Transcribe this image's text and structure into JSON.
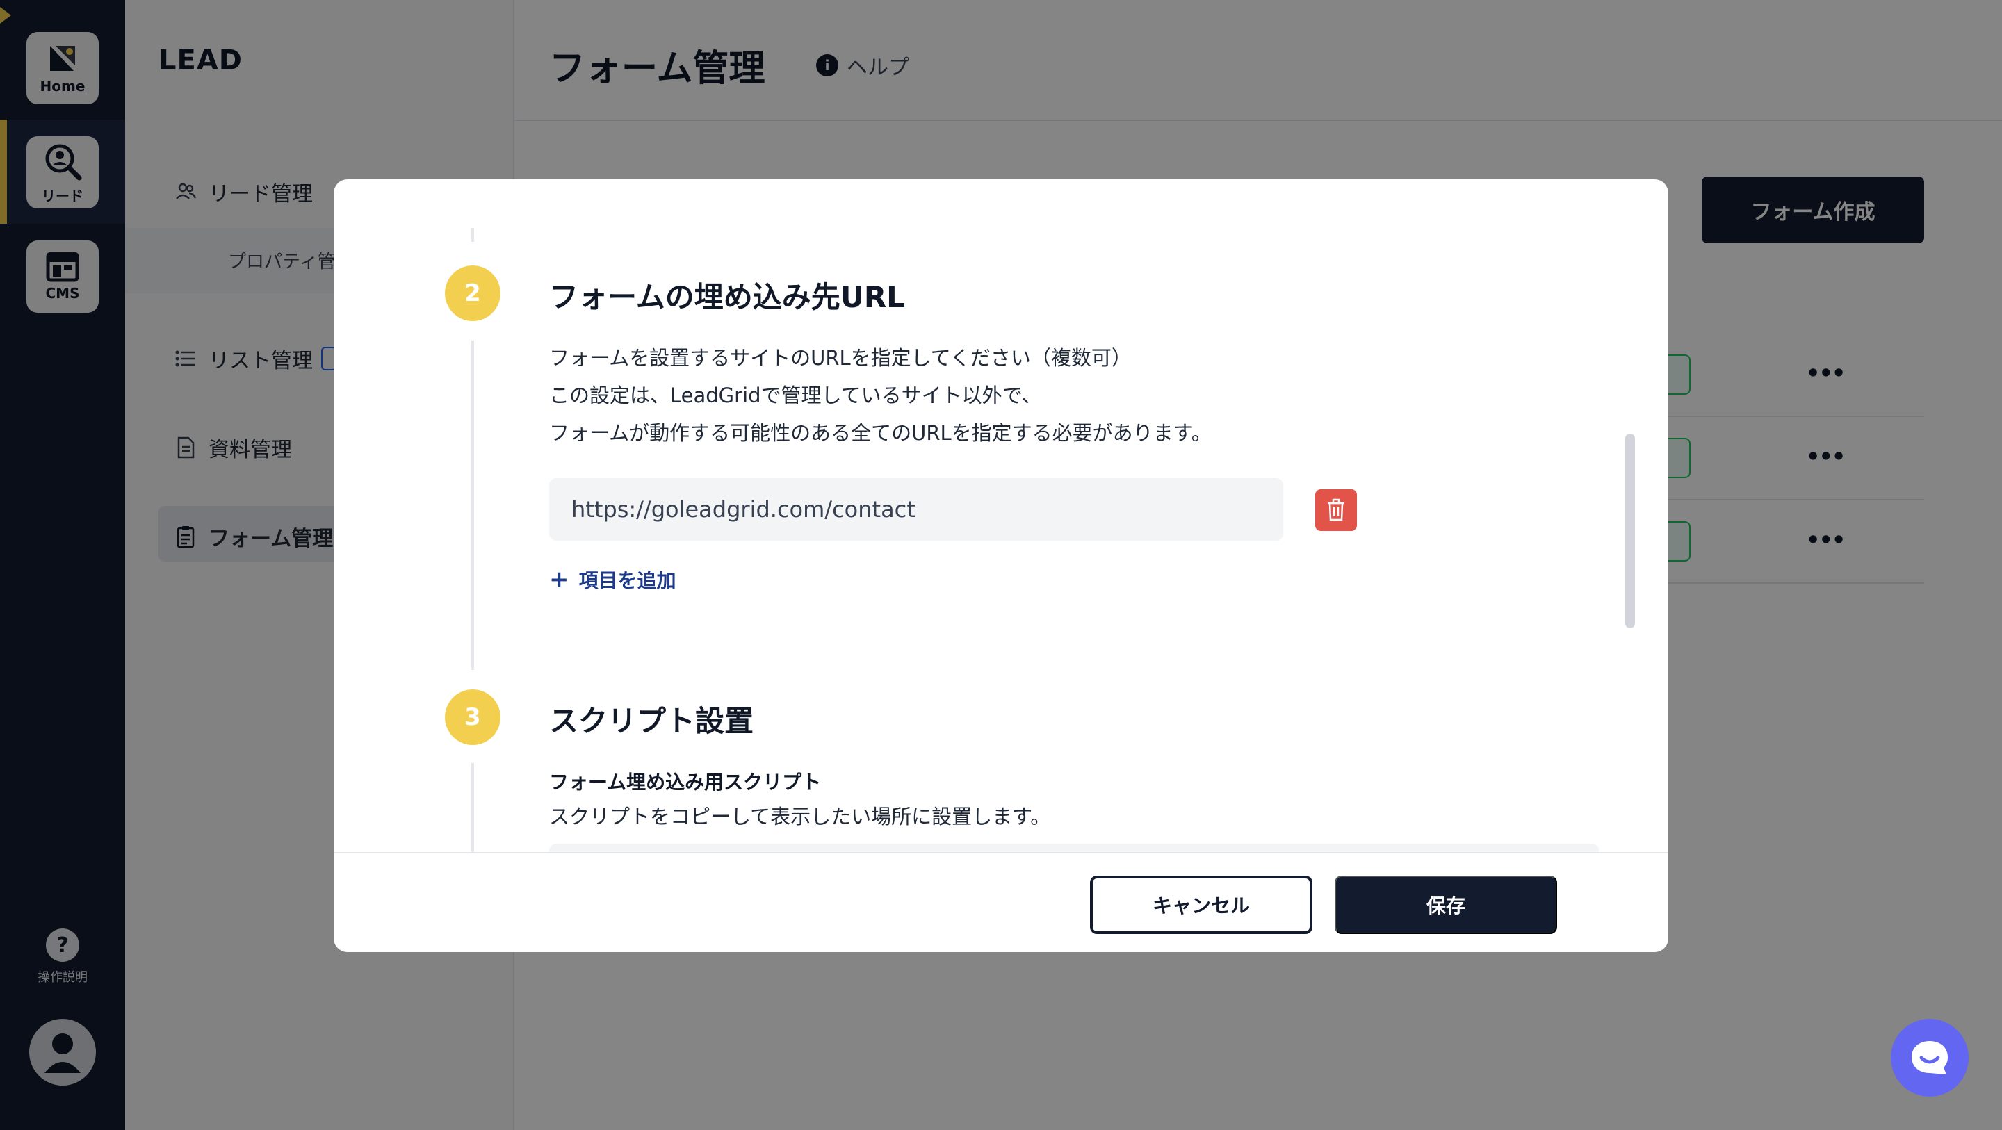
{
  "rail": {
    "home_label": "Home",
    "lead_label": "リード",
    "cms_label": "CMS",
    "help_symbol": "?",
    "help_label": "操作説明",
    "accent_color": "#f3cf4f"
  },
  "sidebar": {
    "title": "LEAD",
    "items": [
      {
        "label": "リード管理",
        "icon": "users-icon"
      },
      {
        "label": "プロパティ管",
        "icon": ""
      },
      {
        "label": "リスト管理",
        "icon": "list-icon"
      },
      {
        "label": "資料管理",
        "icon": "document-icon"
      },
      {
        "label": "フォーム管理",
        "icon": "clipboard-icon"
      }
    ]
  },
  "main": {
    "title": "フォーム管理",
    "help_label": "ヘルプ",
    "help_icon": "info-icon",
    "create_button": "フォーム作成",
    "row_more": "•••"
  },
  "modal": {
    "step2": {
      "number": "2",
      "title": "フォームの埋め込み先URL",
      "desc_lines": [
        "フォームを設置するサイトのURLを指定してください（複数可）",
        "この設定は、LeadGridで管理しているサイト以外で、",
        "フォームが動作する可能性のある全てのURLを指定する必要があります。"
      ],
      "url_value": "https://goleadgrid.com/contact",
      "add_label": "項目を追加"
    },
    "step3": {
      "number": "3",
      "title": "スクリプト設置",
      "sub_title": "フォーム埋め込み用スクリプト",
      "sub_desc": "スクリプトをコピーして表示したい場所に設置します。"
    },
    "footer": {
      "cancel_label": "キャンセル",
      "save_label": "保存"
    },
    "colors": {
      "step_circle": "#f3cf4f",
      "delete": "#e2534a",
      "primary": "#131b2e",
      "link": "#1e3a8a"
    }
  },
  "chat": {
    "icon": "chat-icon",
    "color": "#6366f1"
  }
}
